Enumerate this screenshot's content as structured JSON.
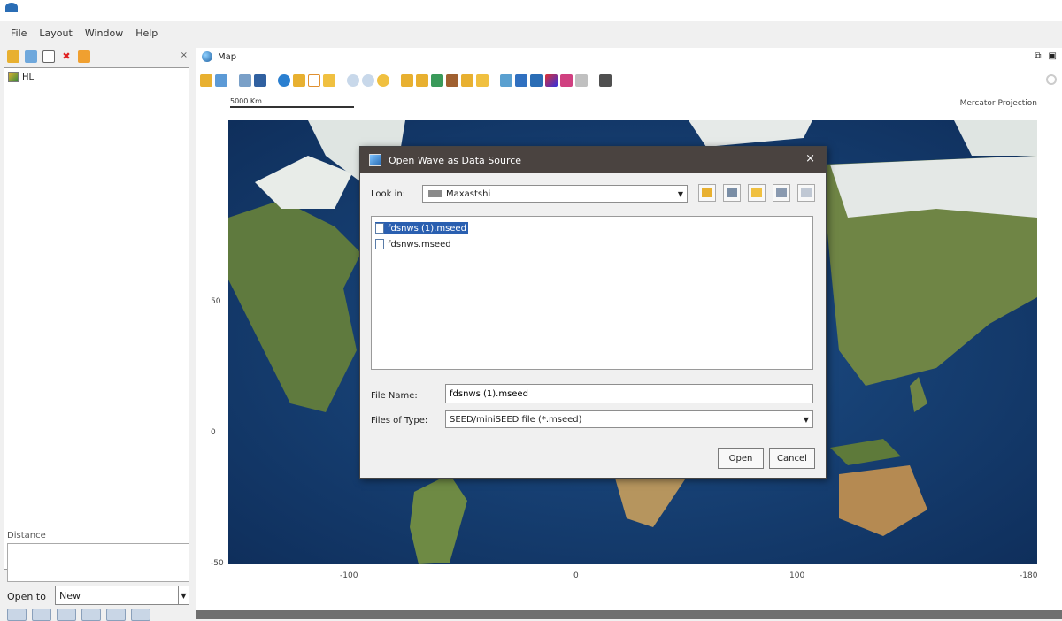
{
  "app": {
    "title": ""
  },
  "menu": [
    {
      "label": "File"
    },
    {
      "label": "Layout"
    },
    {
      "label": "Window"
    },
    {
      "label": "Help"
    }
  ],
  "left_panel": {
    "close_glyph": "×",
    "layers": [
      {
        "label": "HL",
        "icon": "layer-icon"
      }
    ],
    "distance_label": "Distance",
    "open_to_label": "Open to",
    "open_to_value": "New"
  },
  "map_panel": {
    "tab_label": "Map",
    "scale_label": "5000 Km",
    "projection_label": "Mercator Projection",
    "y_ticks": [
      "50",
      "0",
      "-50"
    ],
    "x_ticks": [
      "-100",
      "0",
      "100",
      "-180"
    ]
  },
  "dialog": {
    "title": "Open Wave as Data Source",
    "close_glyph": "×",
    "look_in_label": "Look in:",
    "look_in_value": "Maxastshi",
    "files": [
      {
        "name": "fdsnws (1).mseed",
        "selected": true
      },
      {
        "name": "fdsnws.mseed",
        "selected": false
      }
    ],
    "file_name_label": "File Name:",
    "file_name_value": "fdsnws (1).mseed",
    "files_of_type_label": "Files of Type:",
    "files_of_type_value": "SEED/miniSEED file (*.mseed)",
    "open_label": "Open",
    "cancel_label": "Cancel"
  },
  "colors": {
    "dialog_title_bg": "#4a4340",
    "selection": "#2a5fb0",
    "ocean": "#163f72"
  }
}
